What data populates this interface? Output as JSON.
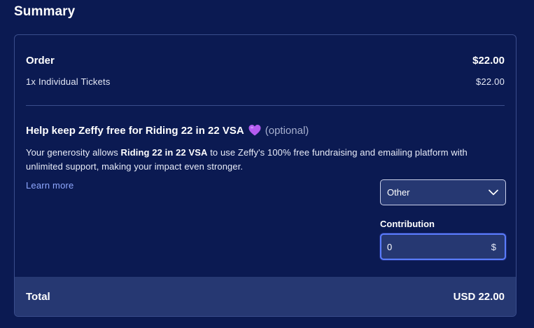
{
  "summary": {
    "title": "Summary"
  },
  "order": {
    "label": "Order",
    "amount": "$22.00",
    "items": [
      {
        "label": "1x Individual Tickets",
        "amount": "$22.00"
      }
    ]
  },
  "support": {
    "title": "Help keep Zeffy free for Riding 22 in 22 VSA",
    "optional_label": "(optional)",
    "desc_prefix": "Your generosity allows ",
    "desc_org": "Riding 22 in 22 VSA",
    "desc_suffix": " to use Zeffy's 100% free fundraising and emailing platform with unlimited support, making your impact even stronger.",
    "learn_more": "Learn more",
    "heart_icon": "purple-heart-icon",
    "heart_color": "#b45cf0",
    "select_value": "Other",
    "contribution_label": "Contribution",
    "contribution_value": "0",
    "currency_symbol": "$"
  },
  "total": {
    "label": "Total",
    "amount": "USD 22.00"
  },
  "colors": {
    "background": "#0b1a52",
    "panel": "#263872",
    "border": "#3a4d8c",
    "link": "#8fa8ff",
    "focus": "#5b7dff"
  }
}
